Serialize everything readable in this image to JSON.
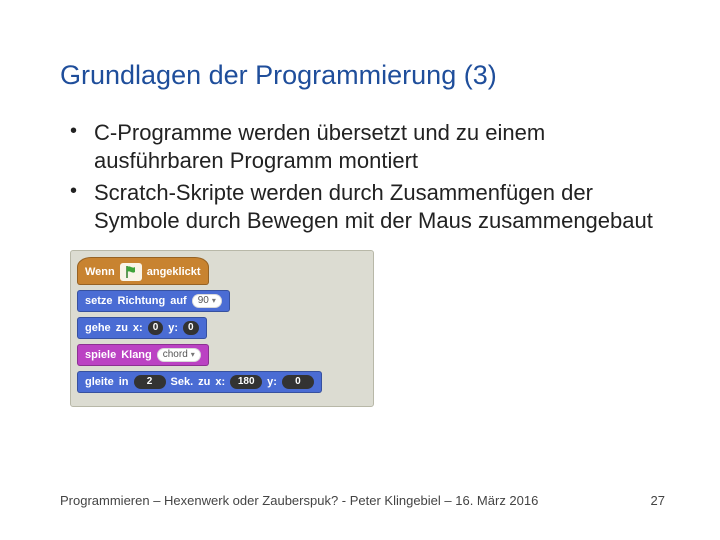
{
  "title": "Grundlagen der Programmierung (3)",
  "bullets": [
    "C-Programme werden übersetzt und zu einem ausführbaren Programm montiert",
    "Scratch-Skripte werden durch Zusammen­fügen der Symbole durch Bewegen mit der Maus zusammengebaut"
  ],
  "scratch": {
    "row1": {
      "wenn": "Wenn",
      "angeklickt": "angeklickt"
    },
    "row2": {
      "setze": "setze",
      "richtung": "Richtung",
      "auf": "auf",
      "val": "90"
    },
    "row3": {
      "gehe": "gehe",
      "zu": "zu",
      "x": "x:",
      "xv": "0",
      "y": "y:",
      "yv": "0"
    },
    "row4": {
      "spiele": "spiele",
      "klang": "Klang",
      "val": "chord"
    },
    "row5": {
      "gleite": "gleite",
      "in": "in",
      "sek": "2",
      "seklbl": "Sek.",
      "zu": "zu",
      "x": "x:",
      "xv": "180",
      "y": "y:",
      "yv": "0"
    }
  },
  "footer": "Programmieren – Hexenwerk oder Zauberspuk? - Peter Klingebiel – 16. März 2016",
  "page": "27"
}
